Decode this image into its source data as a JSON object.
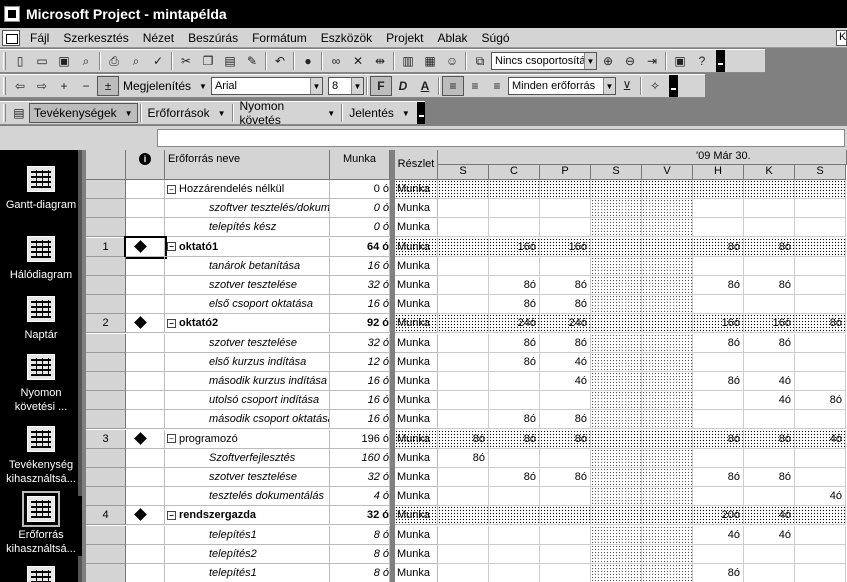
{
  "window": {
    "title": "Microsoft Project - mintapélda"
  },
  "menu": [
    "Fájl",
    "Szerkesztés",
    "Nézet",
    "Beszúrás",
    "Formátum",
    "Eszközök",
    "Projekt",
    "Ablak",
    "Súgó"
  ],
  "help_box": "K",
  "toolbar_standard": {
    "group_combo": "Nincs csoportosítás"
  },
  "toolbar_format": {
    "show_label": "Megjelenítés",
    "font": "Arial",
    "size": "8",
    "bold": "F",
    "italic": "D",
    "underline": "A",
    "filter": "Minden erőforrás"
  },
  "toolbar_tracking": {
    "items": [
      "Tevékenységek",
      "Erőforrások",
      "Nyomon követés",
      "Jelentés"
    ]
  },
  "view_bar": [
    {
      "label": "Gantt-diagram",
      "icon": "gantt-chart-icon"
    },
    {
      "label": "Hálódiagram",
      "icon": "network-diagram-icon"
    },
    {
      "label": "Naptár",
      "icon": "calendar-icon"
    },
    {
      "label": "Nyomon követési ...",
      "icon": "tracking-gantt-icon"
    },
    {
      "label": "Tevékenység kihasználtsá...",
      "icon": "task-usage-icon"
    },
    {
      "label": "Erőforrás kihasználtsá...",
      "icon": "resource-usage-icon"
    }
  ],
  "table": {
    "columns": {
      "info": "i",
      "name": "Erőforrás neve",
      "work": "Munka",
      "detail": "Részlet"
    },
    "timescale": {
      "week_label": "'09 Már 30.",
      "days": [
        "S",
        "C",
        "P",
        "S",
        "V",
        "H",
        "K",
        "S"
      ]
    },
    "rows": [
      {
        "id": "",
        "name": "Hozzárendelés nélkül",
        "work": "0 ó",
        "level": 0,
        "bold": false,
        "detail": "Munka",
        "values": [
          "",
          "",
          "",
          "",
          "",
          "",
          "",
          ""
        ]
      },
      {
        "id": "",
        "name": "szoftver tesztelés/dokum",
        "work": "0 ó",
        "level": 1,
        "detail": "Munka",
        "values": [
          "",
          "",
          "",
          "",
          "",
          "",
          "",
          ""
        ]
      },
      {
        "id": "",
        "name": "telepítés kész",
        "work": "0 ó",
        "level": 1,
        "detail": "Munka",
        "values": [
          "",
          "",
          "",
          "",
          "",
          "",
          "",
          ""
        ]
      },
      {
        "id": "1",
        "name": "oktató1",
        "work": "64 ó",
        "level": 0,
        "bold": true,
        "detail": "Munka",
        "values": [
          "",
          "16ó",
          "16ó",
          "",
          "",
          "8ó",
          "8ó",
          ""
        ]
      },
      {
        "id": "",
        "name": "tanárok betanítása",
        "work": "16 ó",
        "level": 1,
        "detail": "Munka",
        "values": [
          "",
          "",
          "",
          "",
          "",
          "",
          "",
          ""
        ]
      },
      {
        "id": "",
        "name": "szotver tesztelése",
        "work": "32 ó",
        "level": 1,
        "detail": "Munka",
        "values": [
          "",
          "8ó",
          "8ó",
          "",
          "",
          "8ó",
          "8ó",
          ""
        ]
      },
      {
        "id": "",
        "name": "első csoport oktatása",
        "work": "16 ó",
        "level": 1,
        "detail": "Munka",
        "values": [
          "",
          "8ó",
          "8ó",
          "",
          "",
          "",
          "",
          ""
        ]
      },
      {
        "id": "2",
        "name": "oktató2",
        "work": "92 ó",
        "level": 0,
        "bold": true,
        "detail": "Munka",
        "values": [
          "",
          "24ó",
          "24ó",
          "",
          "",
          "16ó",
          "16ó",
          "8ó"
        ]
      },
      {
        "id": "",
        "name": "szotver tesztelése",
        "work": "32 ó",
        "level": 1,
        "detail": "Munka",
        "values": [
          "",
          "8ó",
          "8ó",
          "",
          "",
          "8ó",
          "8ó",
          ""
        ]
      },
      {
        "id": "",
        "name": "első kurzus indítása",
        "work": "12 ó",
        "level": 1,
        "detail": "Munka",
        "values": [
          "",
          "8ó",
          "4ó",
          "",
          "",
          "",
          "",
          ""
        ]
      },
      {
        "id": "",
        "name": "második kurzus indítása",
        "work": "16 ó",
        "level": 1,
        "detail": "Munka",
        "values": [
          "",
          "",
          "4ó",
          "",
          "",
          "8ó",
          "4ó",
          ""
        ]
      },
      {
        "id": "",
        "name": "utolsó csoport indítása",
        "work": "16 ó",
        "level": 1,
        "detail": "Munka",
        "values": [
          "",
          "",
          "",
          "",
          "",
          "",
          "4ó",
          "8ó"
        ]
      },
      {
        "id": "",
        "name": "második csoport oktatása",
        "work": "16 ó",
        "level": 1,
        "detail": "Munka",
        "values": [
          "",
          "8ó",
          "8ó",
          "",
          "",
          "",
          "",
          ""
        ]
      },
      {
        "id": "3",
        "name": "programozó",
        "work": "196 ó",
        "level": 0,
        "bold": false,
        "detail": "Munka",
        "values": [
          "8ó",
          "8ó",
          "8ó",
          "",
          "",
          "8ó",
          "8ó",
          "4ó"
        ]
      },
      {
        "id": "",
        "name": "Szoftverfejlesztés",
        "work": "160 ó",
        "level": 1,
        "detail": "Munka",
        "values": [
          "8ó",
          "",
          "",
          "",
          "",
          "",
          "",
          ""
        ]
      },
      {
        "id": "",
        "name": "szotver tesztelése",
        "work": "32 ó",
        "level": 1,
        "detail": "Munka",
        "values": [
          "",
          "8ó",
          "8ó",
          "",
          "",
          "8ó",
          "8ó",
          ""
        ]
      },
      {
        "id": "",
        "name": "tesztelés dokumentálás",
        "work": "4 ó",
        "level": 1,
        "detail": "Munka",
        "values": [
          "",
          "",
          "",
          "",
          "",
          "",
          "",
          "4ó"
        ]
      },
      {
        "id": "4",
        "name": "rendszergazda",
        "work": "32 ó",
        "level": 0,
        "bold": true,
        "detail": "Munka",
        "values": [
          "",
          "",
          "",
          "",
          "",
          "20ó",
          "4ó",
          ""
        ]
      },
      {
        "id": "",
        "name": "telepítés1",
        "work": "8 ó",
        "level": 1,
        "detail": "Munka",
        "values": [
          "",
          "",
          "",
          "",
          "",
          "4ó",
          "4ó",
          ""
        ]
      },
      {
        "id": "",
        "name": "telepítés2",
        "work": "8 ó",
        "level": 1,
        "detail": "Munka",
        "values": [
          "",
          "",
          "",
          "",
          "",
          "",
          "",
          ""
        ]
      },
      {
        "id": "",
        "name": "telepítés1",
        "work": "8 ó",
        "level": 1,
        "detail": "Munka",
        "values": [
          "",
          "",
          "",
          "",
          "",
          "8ó",
          "",
          ""
        ]
      }
    ]
  }
}
